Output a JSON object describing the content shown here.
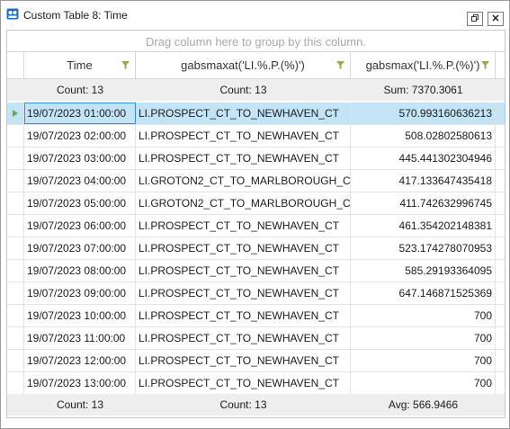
{
  "window": {
    "title": "Custom Table 8: Time"
  },
  "grid": {
    "group_panel_text": "Drag column here to group by this column.",
    "columns": [
      {
        "label": "Time"
      },
      {
        "label": "gabsmaxat('LI.%.P.(%)')"
      },
      {
        "label": "gabsmax('LI.%.P.(%)')"
      }
    ],
    "top_summary": [
      "Count: 13",
      "Count: 13",
      "Sum: 7370.3061"
    ],
    "bottom_summary": [
      "Count: 13",
      "Count: 13",
      "Avg: 566.9466"
    ],
    "selected_row": 0,
    "rows": [
      {
        "time": "19/07/2023 01:00:00",
        "at": "LI.PROSPECT_CT_TO_NEWHAVEN_CT",
        "max": "570.993160636213"
      },
      {
        "time": "19/07/2023 02:00:00",
        "at": "LI.PROSPECT_CT_TO_NEWHAVEN_CT",
        "max": "508.02802580613"
      },
      {
        "time": "19/07/2023 03:00:00",
        "at": "LI.PROSPECT_CT_TO_NEWHAVEN_CT",
        "max": "445.441302304946"
      },
      {
        "time": "19/07/2023 04:00:00",
        "at": "LI.GROTON2_CT_TO_MARLBOROUGH_CT",
        "max": "417.133647435418"
      },
      {
        "time": "19/07/2023 05:00:00",
        "at": "LI.GROTON2_CT_TO_MARLBOROUGH_CT",
        "max": "411.742632996745"
      },
      {
        "time": "19/07/2023 06:00:00",
        "at": "LI.PROSPECT_CT_TO_NEWHAVEN_CT",
        "max": "461.354202148381"
      },
      {
        "time": "19/07/2023 07:00:00",
        "at": "LI.PROSPECT_CT_TO_NEWHAVEN_CT",
        "max": "523.174278070953"
      },
      {
        "time": "19/07/2023 08:00:00",
        "at": "LI.PROSPECT_CT_TO_NEWHAVEN_CT",
        "max": "585.29193364095"
      },
      {
        "time": "19/07/2023 09:00:00",
        "at": "LI.PROSPECT_CT_TO_NEWHAVEN_CT",
        "max": "647.146871525369"
      },
      {
        "time": "19/07/2023 10:00:00",
        "at": "LI.PROSPECT_CT_TO_NEWHAVEN_CT",
        "max": "700"
      },
      {
        "time": "19/07/2023 11:00:00",
        "at": "LI.PROSPECT_CT_TO_NEWHAVEN_CT",
        "max": "700"
      },
      {
        "time": "19/07/2023 12:00:00",
        "at": "LI.PROSPECT_CT_TO_NEWHAVEN_CT",
        "max": "700"
      },
      {
        "time": "19/07/2023 13:00:00",
        "at": "LI.PROSPECT_CT_TO_NEWHAVEN_CT",
        "max": "700"
      }
    ]
  },
  "icons": {
    "app": "grid-table-icon",
    "restore": "restore-window-icon",
    "close": "close-icon",
    "filter": "filter-icon",
    "row_indicator": "current-row-indicator-icon"
  },
  "colors": {
    "selected_row": "#c3e4f7",
    "summary_bg": "#eeeeee",
    "filter_icon": "#9aa84f",
    "indicator": "#6aa84f"
  }
}
